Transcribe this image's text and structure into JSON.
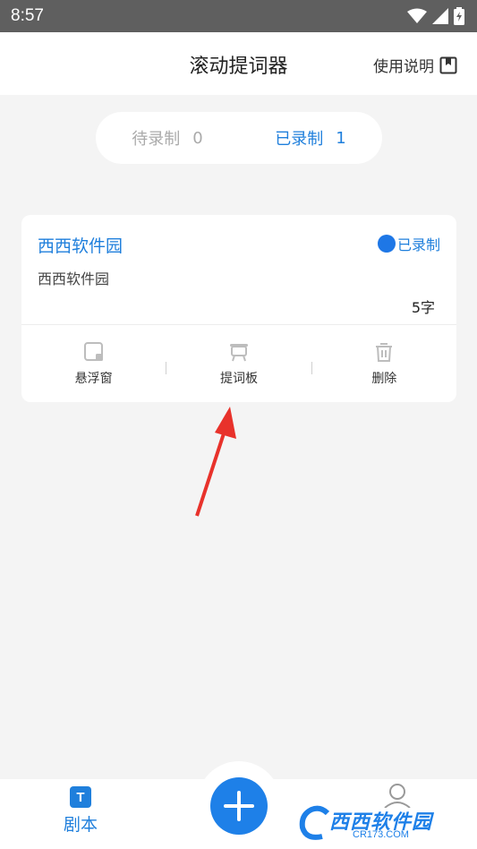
{
  "status_bar": {
    "time": "8:57"
  },
  "header": {
    "title": "滚动提词器",
    "help_label": "使用说明"
  },
  "segments": [
    {
      "label": "待录制",
      "count": "0",
      "active": false
    },
    {
      "label": "已录制",
      "count": "1",
      "active": true
    }
  ],
  "card": {
    "title": "西西软件园",
    "status": "已录制",
    "description": "西西软件园",
    "word_count": "5字",
    "actions": [
      {
        "label": "悬浮窗",
        "icon": "floating-window-icon"
      },
      {
        "label": "提词板",
        "icon": "teleprompter-icon"
      },
      {
        "label": "删除",
        "icon": "trash-icon"
      }
    ]
  },
  "tabbar": {
    "script_label": "剧本",
    "script_icon_text": "T"
  },
  "watermark": {
    "text": "西西软件园",
    "sub": "CR173.COM"
  },
  "colors": {
    "accent": "#1f7fdc",
    "arrow": "#e8322b",
    "status_bar": "#5f5f5f"
  }
}
